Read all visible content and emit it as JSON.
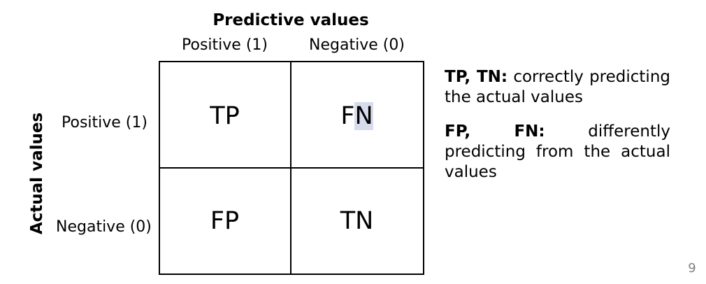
{
  "header": {
    "predicted_title": "Predictive values",
    "columns": [
      {
        "label": "Positive (1)"
      },
      {
        "label": "Negative (0)"
      }
    ]
  },
  "side": {
    "actual_title": "Actual values",
    "rows": [
      {
        "label": "Positive (1)"
      },
      {
        "label": "Negative (0)"
      }
    ]
  },
  "matrix": {
    "cells": {
      "tp": "TP",
      "fn_first": "F",
      "fn_highlight": "N",
      "fp": "FP",
      "tn": "TN"
    }
  },
  "notes": [
    {
      "bold": "TP, TN:",
      "text": " correctly predicting the actual values"
    },
    {
      "bold": "FP, FN:",
      "text": " differently predicting from the actual values"
    }
  ],
  "colors": {
    "text": "#000000",
    "highlight": "#d7dcec",
    "page_number": "#808080"
  },
  "footer": {
    "page_number": "9"
  }
}
